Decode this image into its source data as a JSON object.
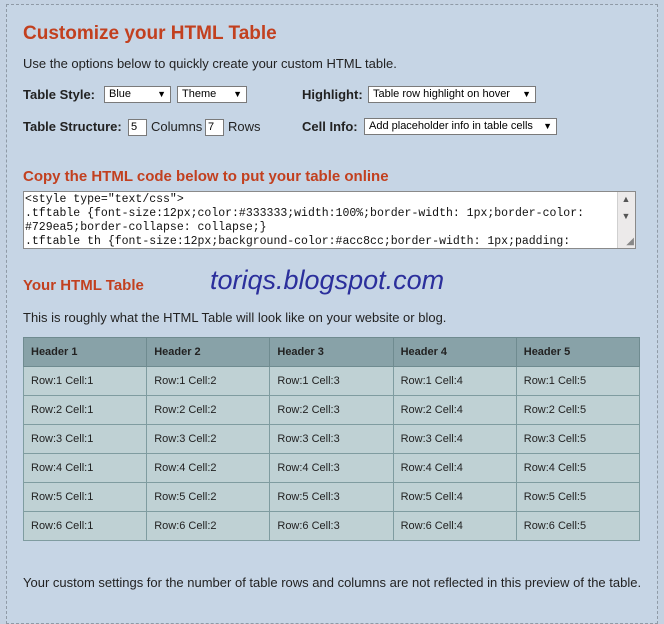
{
  "heading": "Customize your HTML Table",
  "intro": "Use the options below to quickly create your custom HTML table.",
  "options": {
    "style_label": "Table Style:",
    "style_value": "Blue",
    "theme_value": "Theme",
    "highlight_label": "Highlight:",
    "highlight_value": "Table row highlight on hover",
    "structure_label": "Table Structure:",
    "columns_value": "5",
    "columns_label": "Columns",
    "rows_value": "7",
    "rows_label": "Rows",
    "cellinfo_label": "Cell Info:",
    "cellinfo_value": "Add placeholder info in table cells"
  },
  "copy_heading": "Copy the HTML code below to put your table online",
  "code_lines": [
    "<style type=\"text/css\">",
    ".tftable {font-size:12px;color:#333333;width:100%;border-width: 1px;border-color:",
    "#729ea5;border-collapse: collapse;}",
    ".tftable th {font-size:12px;background-color:#acc8cc;border-width: 1px;padding:"
  ],
  "preview_heading": "Your HTML Table",
  "watermark": "toriqs.blogspot.com",
  "preview_desc": "This is roughly what the HTML Table will look like on your website or blog.",
  "table": {
    "headers": [
      "Header 1",
      "Header 2",
      "Header 3",
      "Header 4",
      "Header 5"
    ],
    "rows": [
      [
        "Row:1 Cell:1",
        "Row:1 Cell:2",
        "Row:1 Cell:3",
        "Row:1 Cell:4",
        "Row:1 Cell:5"
      ],
      [
        "Row:2 Cell:1",
        "Row:2 Cell:2",
        "Row:2 Cell:3",
        "Row:2 Cell:4",
        "Row:2 Cell:5"
      ],
      [
        "Row:3 Cell:1",
        "Row:3 Cell:2",
        "Row:3 Cell:3",
        "Row:3 Cell:4",
        "Row:3 Cell:5"
      ],
      [
        "Row:4 Cell:1",
        "Row:4 Cell:2",
        "Row:4 Cell:3",
        "Row:4 Cell:4",
        "Row:4 Cell:5"
      ],
      [
        "Row:5 Cell:1",
        "Row:5 Cell:2",
        "Row:5 Cell:3",
        "Row:5 Cell:4",
        "Row:5 Cell:5"
      ],
      [
        "Row:6 Cell:1",
        "Row:6 Cell:2",
        "Row:6 Cell:3",
        "Row:6 Cell:4",
        "Row:6 Cell:5"
      ]
    ]
  },
  "note": "Your custom settings for the number of table rows and columns are not reflected in this preview of the table.",
  "colors": {
    "page_bg": "#c4d2e2",
    "heading": "#c2401f",
    "header_cell": "#88a2a8",
    "body_cell": "#bfd1d4",
    "watermark": "#2b2f9c"
  },
  "icons": {
    "dropdown": "chevron-down-icon",
    "scroll_up": "arrow-up-icon",
    "scroll_down": "arrow-down-icon",
    "resize": "resize-grip-icon"
  }
}
